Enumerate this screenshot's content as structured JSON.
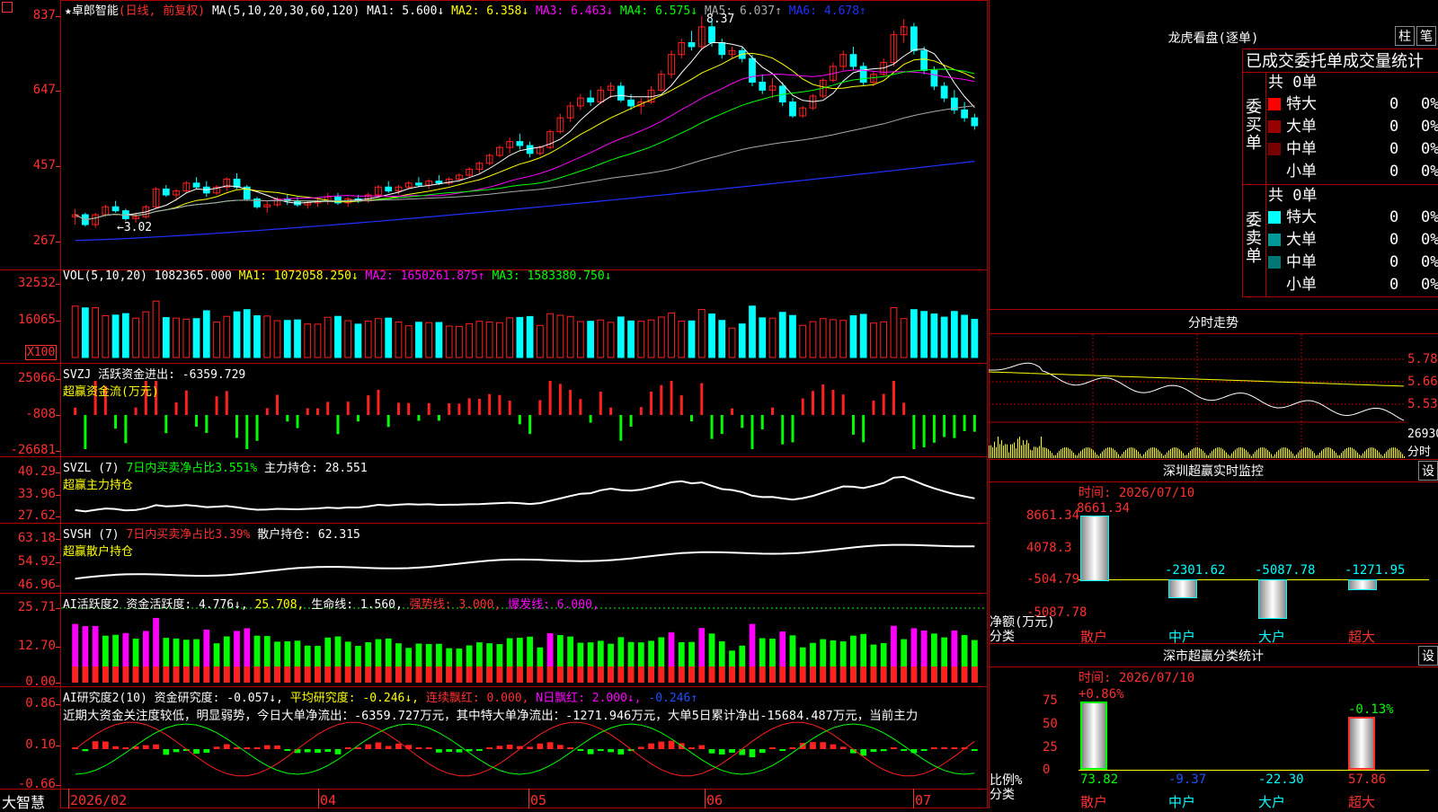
{
  "app": {
    "brand": "大智慧",
    "stock_title": "★卓郎智能",
    "period_label": "(日线, 前复权)"
  },
  "colors": {
    "up": "#ff2020",
    "down": "#00ffff",
    "grid": "#b00000",
    "ma1": "#ffffff",
    "ma2": "#ffff00",
    "ma3": "#ff00ff",
    "ma4": "#00ff00",
    "ma5": "#aaaaaa",
    "ma6": "#2030ff"
  },
  "main_chart": {
    "ma_header": "MA(5,10,20,30,60,120)",
    "ma_values": [
      {
        "label": "MA1: 5.600",
        "arrow": "↓",
        "color": "#ffffff"
      },
      {
        "label": "MA2: 6.358",
        "arrow": "↓",
        "color": "#ffff00"
      },
      {
        "label": "MA3: 6.463",
        "arrow": "↓",
        "color": "#ff00ff"
      },
      {
        "label": "MA4: 6.575",
        "arrow": "↓",
        "color": "#00ff00"
      },
      {
        "label": "MA5: 6.037",
        "arrow": "↑",
        "color": "#aaaaaa"
      },
      {
        "label": "MA6: 4.678",
        "arrow": "↑",
        "color": "#2030ff"
      }
    ],
    "yticks": [
      "837",
      "647",
      "457",
      "267"
    ],
    "high_marker": "8.37",
    "low_marker": "←3.02",
    "candles_ohlc": [
      [
        3.3,
        3.5,
        3.1,
        3.35
      ],
      [
        3.35,
        3.4,
        3.05,
        3.1
      ],
      [
        3.1,
        3.4,
        3.02,
        3.35
      ],
      [
        3.35,
        3.6,
        3.3,
        3.55
      ],
      [
        3.55,
        3.7,
        3.4,
        3.45
      ],
      [
        3.45,
        3.5,
        3.2,
        3.25
      ],
      [
        3.25,
        3.4,
        3.15,
        3.3
      ],
      [
        3.3,
        3.6,
        3.25,
        3.55
      ],
      [
        3.55,
        4.05,
        3.5,
        4.0
      ],
      [
        4.0,
        4.1,
        3.8,
        3.85
      ],
      [
        3.85,
        4.0,
        3.7,
        3.95
      ],
      [
        3.95,
        4.2,
        3.9,
        4.15
      ],
      [
        4.15,
        4.3,
        4.0,
        4.05
      ],
      [
        4.05,
        4.2,
        3.8,
        3.9
      ],
      [
        3.9,
        4.1,
        3.85,
        4.05
      ],
      [
        4.05,
        4.3,
        3.95,
        4.25
      ],
      [
        4.25,
        4.4,
        4.0,
        4.05
      ],
      [
        4.05,
        4.1,
        3.7,
        3.75
      ],
      [
        3.75,
        3.8,
        3.5,
        3.55
      ],
      [
        3.55,
        3.7,
        3.4,
        3.6
      ],
      [
        3.6,
        3.8,
        3.55,
        3.75
      ],
      [
        3.75,
        3.85,
        3.6,
        3.7
      ],
      [
        3.7,
        3.8,
        3.55,
        3.6
      ],
      [
        3.6,
        3.7,
        3.5,
        3.65
      ],
      [
        3.65,
        3.75,
        3.55,
        3.7
      ],
      [
        3.7,
        3.9,
        3.6,
        3.8
      ],
      [
        3.8,
        3.9,
        3.6,
        3.65
      ],
      [
        3.65,
        3.8,
        3.55,
        3.75
      ],
      [
        3.75,
        3.85,
        3.65,
        3.7
      ],
      [
        3.7,
        3.9,
        3.65,
        3.85
      ],
      [
        3.85,
        4.1,
        3.8,
        4.05
      ],
      [
        4.05,
        4.2,
        3.9,
        3.95
      ],
      [
        3.95,
        4.1,
        3.85,
        4.05
      ],
      [
        4.05,
        4.2,
        4.0,
        4.15
      ],
      [
        4.15,
        4.3,
        4.05,
        4.1
      ],
      [
        4.1,
        4.25,
        4.0,
        4.2
      ],
      [
        4.2,
        4.35,
        4.1,
        4.15
      ],
      [
        4.15,
        4.3,
        4.1,
        4.25
      ],
      [
        4.25,
        4.4,
        4.2,
        4.35
      ],
      [
        4.35,
        4.55,
        4.3,
        4.5
      ],
      [
        4.5,
        4.7,
        4.4,
        4.65
      ],
      [
        4.65,
        4.9,
        4.6,
        4.85
      ],
      [
        4.85,
        5.1,
        4.8,
        5.05
      ],
      [
        5.05,
        5.3,
        4.9,
        5.2
      ],
      [
        5.2,
        5.4,
        5.0,
        5.1
      ],
      [
        5.1,
        5.2,
        4.8,
        4.9
      ],
      [
        4.9,
        5.1,
        4.85,
        5.05
      ],
      [
        5.05,
        5.5,
        5.0,
        5.45
      ],
      [
        5.45,
        5.9,
        5.4,
        5.8
      ],
      [
        5.8,
        6.2,
        5.7,
        6.1
      ],
      [
        6.1,
        6.4,
        6.0,
        6.3
      ],
      [
        6.3,
        6.5,
        6.1,
        6.2
      ],
      [
        6.2,
        6.6,
        6.15,
        6.5
      ],
      [
        6.5,
        6.7,
        6.3,
        6.6
      ],
      [
        6.6,
        6.7,
        6.2,
        6.25
      ],
      [
        6.25,
        6.4,
        6.0,
        6.1
      ],
      [
        6.1,
        6.3,
        5.9,
        6.2
      ],
      [
        6.2,
        6.6,
        6.15,
        6.5
      ],
      [
        6.5,
        7.0,
        6.45,
        6.9
      ],
      [
        6.9,
        7.5,
        6.8,
        7.4
      ],
      [
        7.4,
        7.8,
        7.3,
        7.7
      ],
      [
        7.7,
        8.0,
        7.5,
        7.6
      ],
      [
        7.6,
        8.37,
        7.5,
        8.1
      ],
      [
        8.1,
        8.3,
        7.6,
        7.7
      ],
      [
        7.7,
        7.8,
        7.3,
        7.4
      ],
      [
        7.4,
        7.6,
        7.3,
        7.5
      ],
      [
        7.5,
        7.6,
        7.2,
        7.3
      ],
      [
        7.3,
        7.4,
        6.6,
        6.7
      ],
      [
        6.7,
        6.9,
        6.4,
        6.5
      ],
      [
        6.5,
        6.8,
        6.3,
        6.6
      ],
      [
        6.6,
        6.7,
        6.1,
        6.2
      ],
      [
        6.2,
        6.3,
        5.8,
        5.85
      ],
      [
        5.85,
        6.1,
        5.8,
        6.05
      ],
      [
        6.05,
        6.4,
        6.0,
        6.35
      ],
      [
        6.35,
        6.8,
        6.3,
        6.75
      ],
      [
        6.75,
        7.2,
        6.7,
        7.1
      ],
      [
        7.1,
        7.5,
        7.0,
        7.4
      ],
      [
        7.4,
        7.6,
        7.0,
        7.1
      ],
      [
        7.1,
        7.2,
        6.6,
        6.7
      ],
      [
        6.7,
        7.0,
        6.6,
        6.9
      ],
      [
        6.9,
        7.3,
        6.85,
        7.2
      ],
      [
        7.2,
        8.0,
        7.1,
        7.9
      ],
      [
        7.9,
        8.3,
        7.7,
        8.1
      ],
      [
        8.1,
        8.2,
        7.4,
        7.5
      ],
      [
        7.5,
        7.6,
        6.9,
        7.0
      ],
      [
        7.0,
        7.1,
        6.5,
        6.6
      ],
      [
        6.6,
        6.7,
        6.2,
        6.3
      ],
      [
        6.3,
        6.5,
        5.9,
        6.0
      ],
      [
        6.0,
        6.2,
        5.7,
        5.8
      ],
      [
        5.8,
        5.9,
        5.5,
        5.6
      ]
    ]
  },
  "vol_panel": {
    "header": "VOL(5,10,20)",
    "value": "1082365.000",
    "ma_values": [
      {
        "label": "MA1: 1072058.250",
        "arrow": "↓",
        "color": "#ffff00"
      },
      {
        "label": "MA2: 1650261.875",
        "arrow": "↑",
        "color": "#ff00ff"
      },
      {
        "label": "MA3: 1583380.750",
        "arrow": "↓",
        "color": "#00ff00"
      }
    ],
    "yticks": [
      "32532",
      "16065"
    ],
    "unit": "X100"
  },
  "svzj_panel": {
    "line1": "SVZJ  活跃资金进出: -6359.729",
    "line2": "超赢资金流(万元)",
    "yticks": [
      "25066",
      "-808",
      "-26681"
    ]
  },
  "svzl_panel": {
    "line1a": "SVZL (7)",
    "line1b": "7日内买卖净占比3.551%",
    "line1c": "主力持仓: 28.551",
    "line2": "超赢主力持仓",
    "yticks": [
      "40.29",
      "33.96",
      "27.62"
    ]
  },
  "svsh_panel": {
    "line1a": "SVSH (7)",
    "line1b": "7日内买卖净占比3.39%",
    "line1c": "散户持仓: 62.315",
    "line2": "超赢散户持仓",
    "yticks": [
      "63.18",
      "54.92",
      "46.96"
    ]
  },
  "ai_active_panel": {
    "header": "AI活跃度2",
    "items": [
      {
        "label": "资金活跃度: 4.776",
        "arrow": "↓,",
        "color": "#ffffff"
      },
      {
        "label": "25.708",
        "arrow": ",",
        "color": "#ffff00"
      },
      {
        "label": "生命线: 1.560",
        "arrow": ",",
        "color": "#ffffff"
      },
      {
        "label": "强势线: 3.000",
        "arrow": ",",
        "color": "#ff3030"
      },
      {
        "label": "爆发线: 6.000",
        "arrow": ",",
        "color": "#ff00ff"
      }
    ],
    "yticks": [
      "25.71",
      "12.70",
      "0.00"
    ]
  },
  "ai_research_panel": {
    "header": "AI研究度2(10)",
    "items": [
      {
        "label": "资金研究度: -0.057",
        "arrow": "↓,",
        "color": "#ffffff"
      },
      {
        "label": "平均研究度: -0.246",
        "arrow": "↓,",
        "color": "#ffff00"
      },
      {
        "label": "连续飘红: 0.000",
        "arrow": ",",
        "color": "#ff3030"
      },
      {
        "label": "N日飘红: 2.000",
        "arrow": "↓,",
        "color": "#ff00ff"
      },
      {
        "label": "-0.246",
        "arrow": "↑",
        "color": "#2050ff"
      }
    ],
    "commentary": "近期大资金关注度较低，明显弱势，今日大单净流出：-6359.727万元，其中特大单净流出：-1271.946万元，大单5日累计净出-15684.487万元，当前主力",
    "yticks": [
      "0.86",
      "0.10",
      "-0.66"
    ]
  },
  "x_axis": {
    "labels": [
      "2026/02",
      "04",
      "05",
      "06",
      "07"
    ]
  },
  "right_panel": {
    "lhb_title": "龙虎看盘(逐单)",
    "btn_zhu": "柱",
    "btn_bi": "笔",
    "table_header": "已成交委托单成交量统计",
    "buy_side_label": "委买单",
    "sell_side_label": "委卖单",
    "buy_total": "共 0单",
    "sell_total": "共 0单",
    "buy_rows": [
      {
        "name": "特大",
        "count": "0",
        "pct": "0%",
        "color": "#ff0000"
      },
      {
        "name": "大单",
        "count": "0",
        "pct": "0%",
        "color": "#990000"
      },
      {
        "name": "中单",
        "count": "0",
        "pct": "0%",
        "color": "#770000"
      },
      {
        "name": "小单",
        "count": "0",
        "pct": "0%",
        "color": "#000000"
      }
    ],
    "sell_rows": [
      {
        "name": "特大",
        "count": "0",
        "pct": "0%",
        "color": "#00ffff"
      },
      {
        "name": "大单",
        "count": "0",
        "pct": "0%",
        "color": "#009999"
      },
      {
        "name": "中单",
        "count": "0",
        "pct": "0%",
        "color": "#007777"
      },
      {
        "name": "小单",
        "count": "0",
        "pct": "0%",
        "color": "#000000"
      }
    ],
    "intraday_title": "分时走势",
    "intraday_yticks": [
      "5.78",
      "5.66",
      "5.53"
    ],
    "intraday_vol": "26930",
    "intraday_foot": "分时",
    "sz_monitor_title": "深圳超赢实时监控",
    "sz_time": "时间: 2026/07/10",
    "sz_yticks": [
      "8661.34",
      "4078.3",
      "-504.79",
      "-5087.78"
    ],
    "sz_unit_label": "净额(万元)",
    "sz_cat_label": "分类",
    "sz_bars": [
      {
        "cat": "散户",
        "value": 8661.34,
        "label": "8661.34"
      },
      {
        "cat": "中户",
        "value": -2301.62,
        "label": "-2301.62"
      },
      {
        "cat": "大户",
        "value": -5087.78,
        "label": "-5087.78"
      },
      {
        "cat": "超大",
        "value": -1271.95,
        "label": "-1271.95"
      }
    ],
    "sz_class_title": "深市超赢分类统计",
    "sz_class_time": "时间: 2026/07/10",
    "sz_class_yticks": [
      "75",
      "50",
      "25",
      "0"
    ],
    "sz_class_top": [
      "+0.86%",
      "-0.13%"
    ],
    "sz_class_unit": "比例%",
    "sz_class_cat": "分类",
    "sz_class_values": [
      {
        "cat": "散户",
        "value": 73.82,
        "label": "73.82",
        "color": "#00ff00"
      },
      {
        "cat": "中户",
        "value": -9.37,
        "label": "-9.37",
        "color": "#2050ff"
      },
      {
        "cat": "大户",
        "value": -22.3,
        "label": "-22.30",
        "color": "#00ffff"
      },
      {
        "cat": "超大",
        "value": 57.86,
        "label": "57.86",
        "color": "#ff3030"
      }
    ],
    "set_btn": "设"
  }
}
